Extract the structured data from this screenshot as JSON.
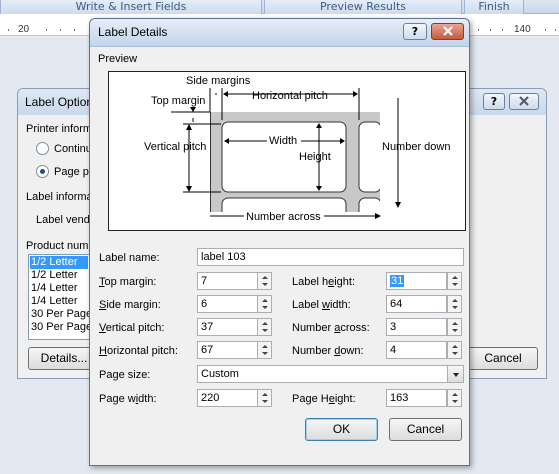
{
  "ribbon": {
    "tab_write": "Write & Insert Fields",
    "tab_preview": "Preview Results",
    "tab_finish": "Finish",
    "ruler_left": "20",
    "ruler_right": "140"
  },
  "bg_dialog": {
    "title": "Label Optior",
    "help_btn": "?",
    "printer_info": "Printer inform",
    "continuous": "Continu",
    "page_printers": "Page pri",
    "label_info": "Label informa",
    "label_vendor": "Label vendo",
    "product_number": "Product numb",
    "products": [
      "1/2 Letter",
      "1/2 Letter",
      "1/4 Letter",
      "1/4 Letter",
      "30 Per Page",
      "30 Per Page"
    ],
    "details_btn": "Details...",
    "cancel_btn": "Cancel"
  },
  "dialog": {
    "title": "Label Details",
    "help_btn": "?",
    "preview_label": "Preview",
    "diagram": {
      "side_margins": "Side margins",
      "top_margin": "Top margin",
      "horizontal_pitch": "Horizontal pitch",
      "vertical_pitch": "Vertical pitch",
      "width": "Width",
      "height": "Height",
      "number_down": "Number down",
      "number_across": "Number across"
    },
    "fields": {
      "label_name": {
        "label": "Label name:",
        "value": "label 103"
      },
      "top_margin": {
        "label_pre": "",
        "label_u": "T",
        "label_post": "op margin:",
        "value": "7"
      },
      "label_height": {
        "label_pre": "Label h",
        "label_u": "e",
        "label_post": "ight:",
        "value": "31"
      },
      "side_margin": {
        "label_pre": "",
        "label_u": "S",
        "label_post": "ide margin:",
        "value": "6"
      },
      "label_width": {
        "label_pre": "Label ",
        "label_u": "w",
        "label_post": "idth:",
        "value": "64"
      },
      "vertical_pitch": {
        "label_pre": "",
        "label_u": "V",
        "label_post": "ertical pitch:",
        "value": "37"
      },
      "number_across": {
        "label_pre": "Number ",
        "label_u": "a",
        "label_post": "cross:",
        "value": "3"
      },
      "horizontal_pitch": {
        "label_pre": "",
        "label_u": "H",
        "label_post": "orizontal pitch:",
        "value": "67"
      },
      "number_down": {
        "label_pre": "Number ",
        "label_u": "d",
        "label_post": "own:",
        "value": "4"
      },
      "page_size": {
        "label": "Page size:",
        "value": "Custom"
      },
      "page_width": {
        "label_pre": "Page w",
        "label_u": "i",
        "label_post": "dth:",
        "value": "220"
      },
      "page_height": {
        "label_pre": "Page H",
        "label_u": "e",
        "label_post": "ight:",
        "value": "163"
      }
    },
    "ok_btn": "OK",
    "cancel_btn": "Cancel"
  }
}
